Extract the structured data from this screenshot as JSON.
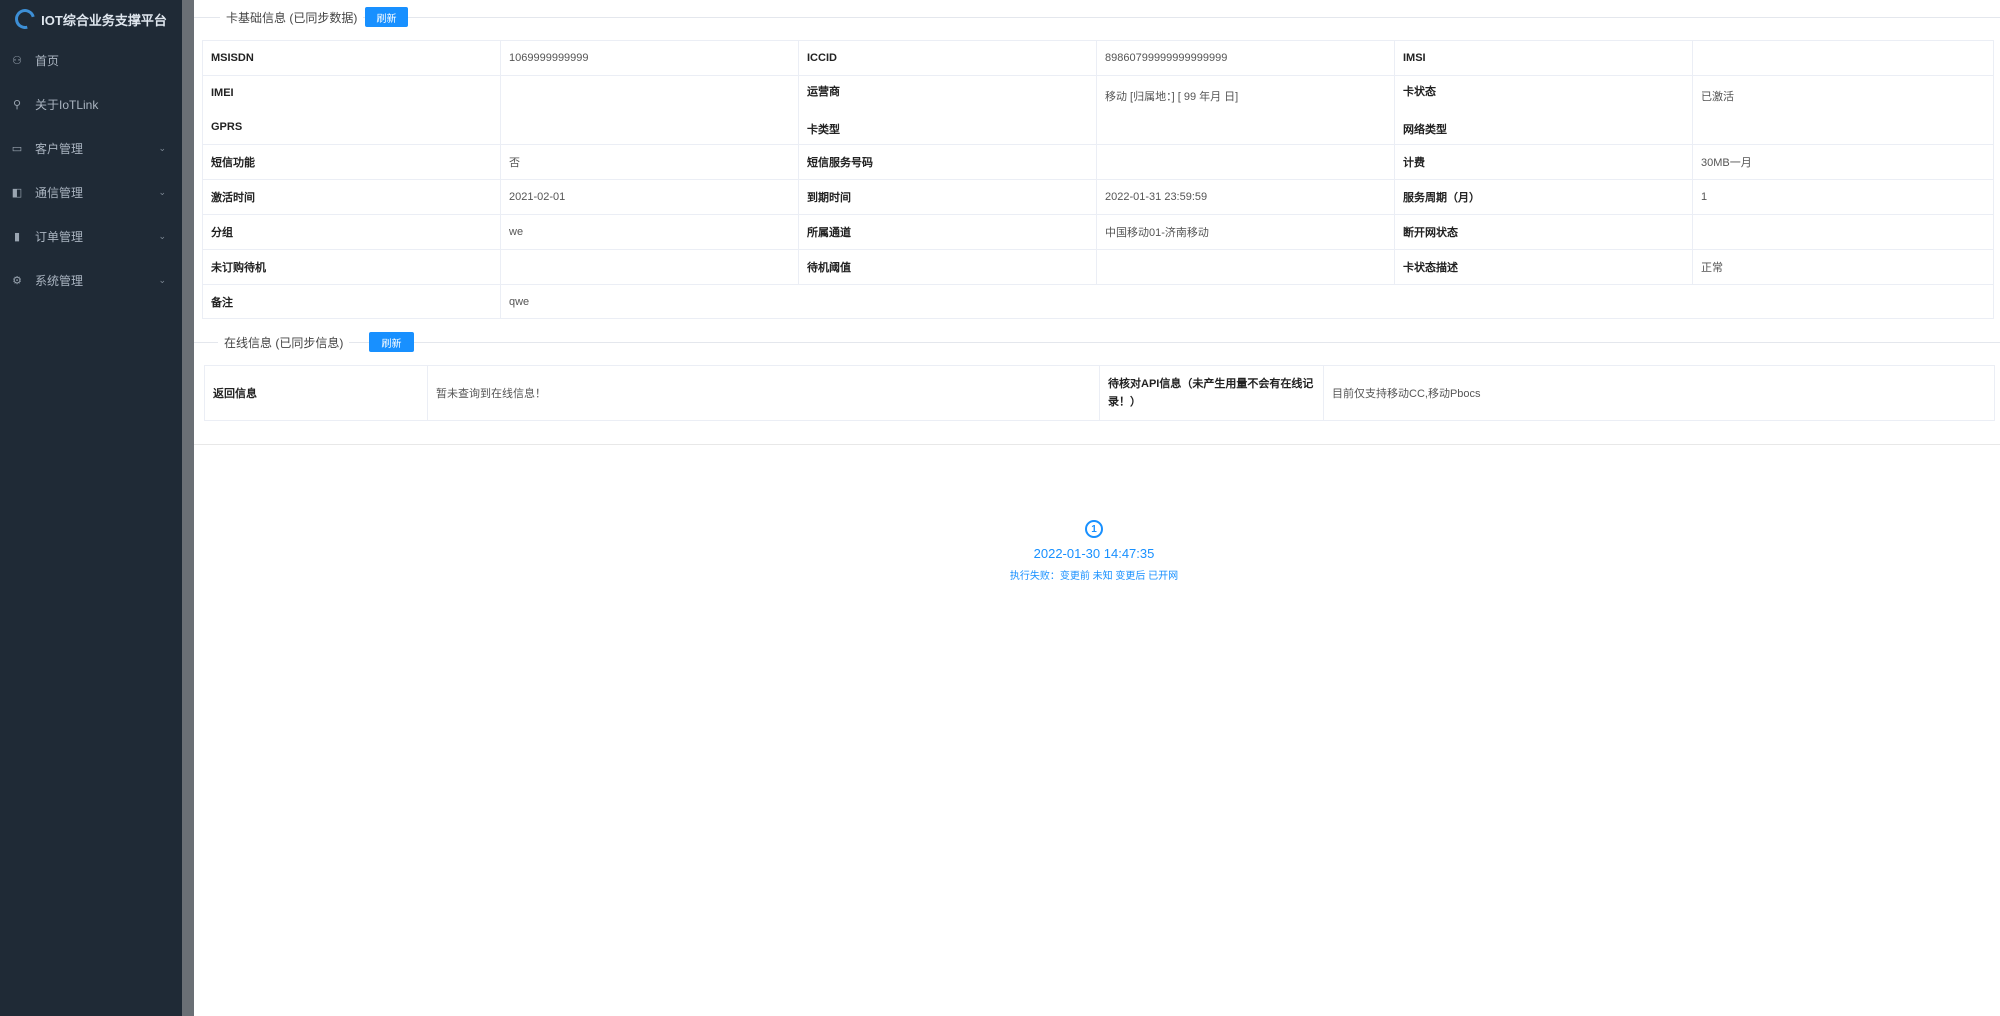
{
  "app": {
    "title": "IOT综合业务支撑平台"
  },
  "sidebar": {
    "items": [
      {
        "label": "首页",
        "icon": "dashboard-icon",
        "glyph": "⚇",
        "has_children": false
      },
      {
        "label": "关于IoTLink",
        "icon": "guide-icon",
        "glyph": "⚲",
        "has_children": false
      },
      {
        "label": "客户管理",
        "icon": "monitor-icon",
        "glyph": "▭",
        "has_children": true
      },
      {
        "label": "通信管理",
        "icon": "card-icon",
        "glyph": "◧",
        "has_children": true
      },
      {
        "label": "订单管理",
        "icon": "chart-icon",
        "glyph": "▮",
        "has_children": true
      },
      {
        "label": "系统管理",
        "icon": "gear-icon",
        "glyph": "⚙",
        "has_children": true
      }
    ]
  },
  "card_section": {
    "title": "卡基础信息 (已同步数据)",
    "button": "刷新"
  },
  "card_table": {
    "r1": {
      "k1": "MSISDN",
      "v1": "1069999999999",
      "k2": "ICCID",
      "v2": "89860799999999999999",
      "k3": "IMSI",
      "v3": ""
    },
    "r2": {
      "k1a": "IMEI",
      "k1b": "GPRS",
      "v1": "",
      "k2a": "运营商",
      "k2b": "卡类型",
      "v2": "移动 [归属地：] [ 99 年月 日]",
      "k3a": "卡状态",
      "k3b": "网络类型",
      "v3": "已激活"
    },
    "r3": {
      "k1": "短信功能",
      "v1": "否",
      "k2": "短信服务号码",
      "v2": "",
      "k3": "计费",
      "v3": "30MB一月"
    },
    "r4": {
      "k1": "激活时间",
      "v1": "2021-02-01",
      "k2": "到期时间",
      "v2": "2022-01-31 23:59:59",
      "k3": "服务周期（月）",
      "v3": "1"
    },
    "r5": {
      "k1": "分组",
      "v1": "we",
      "k2": "所属通道",
      "v2": "中国移动01-济南移动",
      "k3": "断开网状态",
      "v3": ""
    },
    "r6": {
      "k1": "未订购待机",
      "v1": "",
      "k2": "待机阈值",
      "v2": "",
      "k3": "卡状态描述",
      "v3": "正常"
    },
    "r7": {
      "k1": "备注",
      "v1": "qwe"
    }
  },
  "online_section": {
    "title": "在线信息 (已同步信息)",
    "button": "刷新"
  },
  "online_table": {
    "k1": "返回信息",
    "v1": "暂未查询到在线信息！",
    "k2": "待核对API信息（未产生用量不会有在线记录！）",
    "v2": "目前仅支持移动CC,移动Pbocs"
  },
  "timeline": {
    "index": "1",
    "time": "2022-01-30 14:47:35",
    "desc": "执行失败：变更前 未知 变更后 已开网"
  },
  "colors": {
    "accent": "#1890ff",
    "sidebar_bg": "#1f2a36"
  }
}
